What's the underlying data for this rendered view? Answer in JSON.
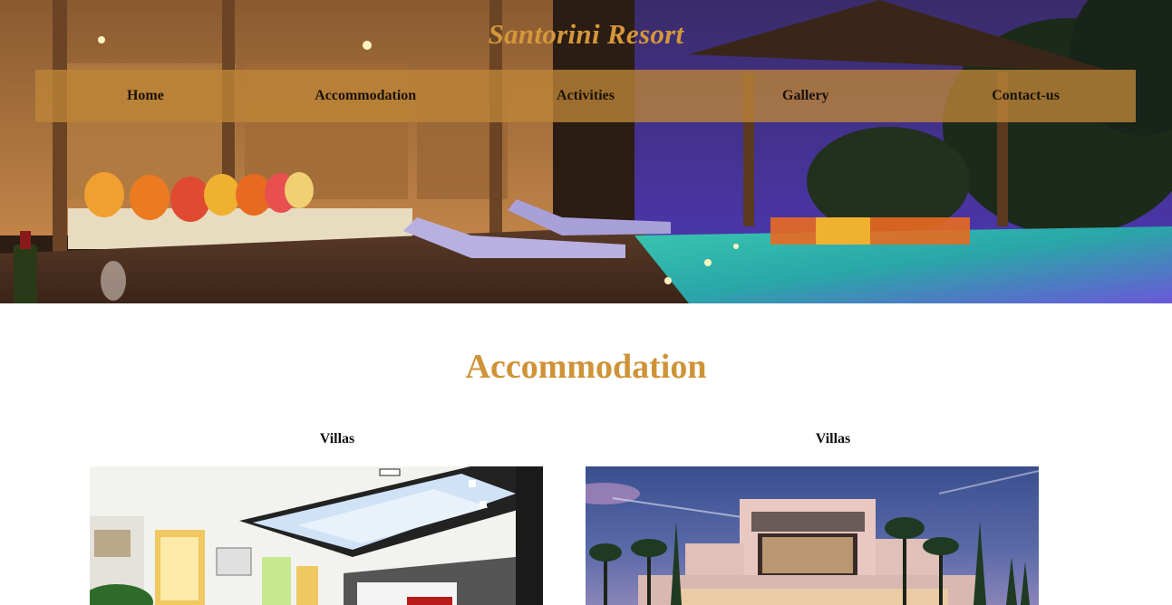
{
  "site": {
    "title": "Santorini Resort"
  },
  "nav": {
    "items": [
      {
        "label": "Home"
      },
      {
        "label": "Accommodation"
      },
      {
        "label": "Activities"
      },
      {
        "label": "Gallery"
      },
      {
        "label": "Contact-us"
      }
    ]
  },
  "main": {
    "section_title": "Accommodation",
    "cards": [
      {
        "label": "Villas",
        "image": "interior-living-room-photo"
      },
      {
        "label": "Villas",
        "image": "modern-villa-exterior-photo"
      }
    ]
  },
  "colors": {
    "title_gold": "#d4973b",
    "nav_bar": "#be8537",
    "section_title": "#cf9337"
  }
}
